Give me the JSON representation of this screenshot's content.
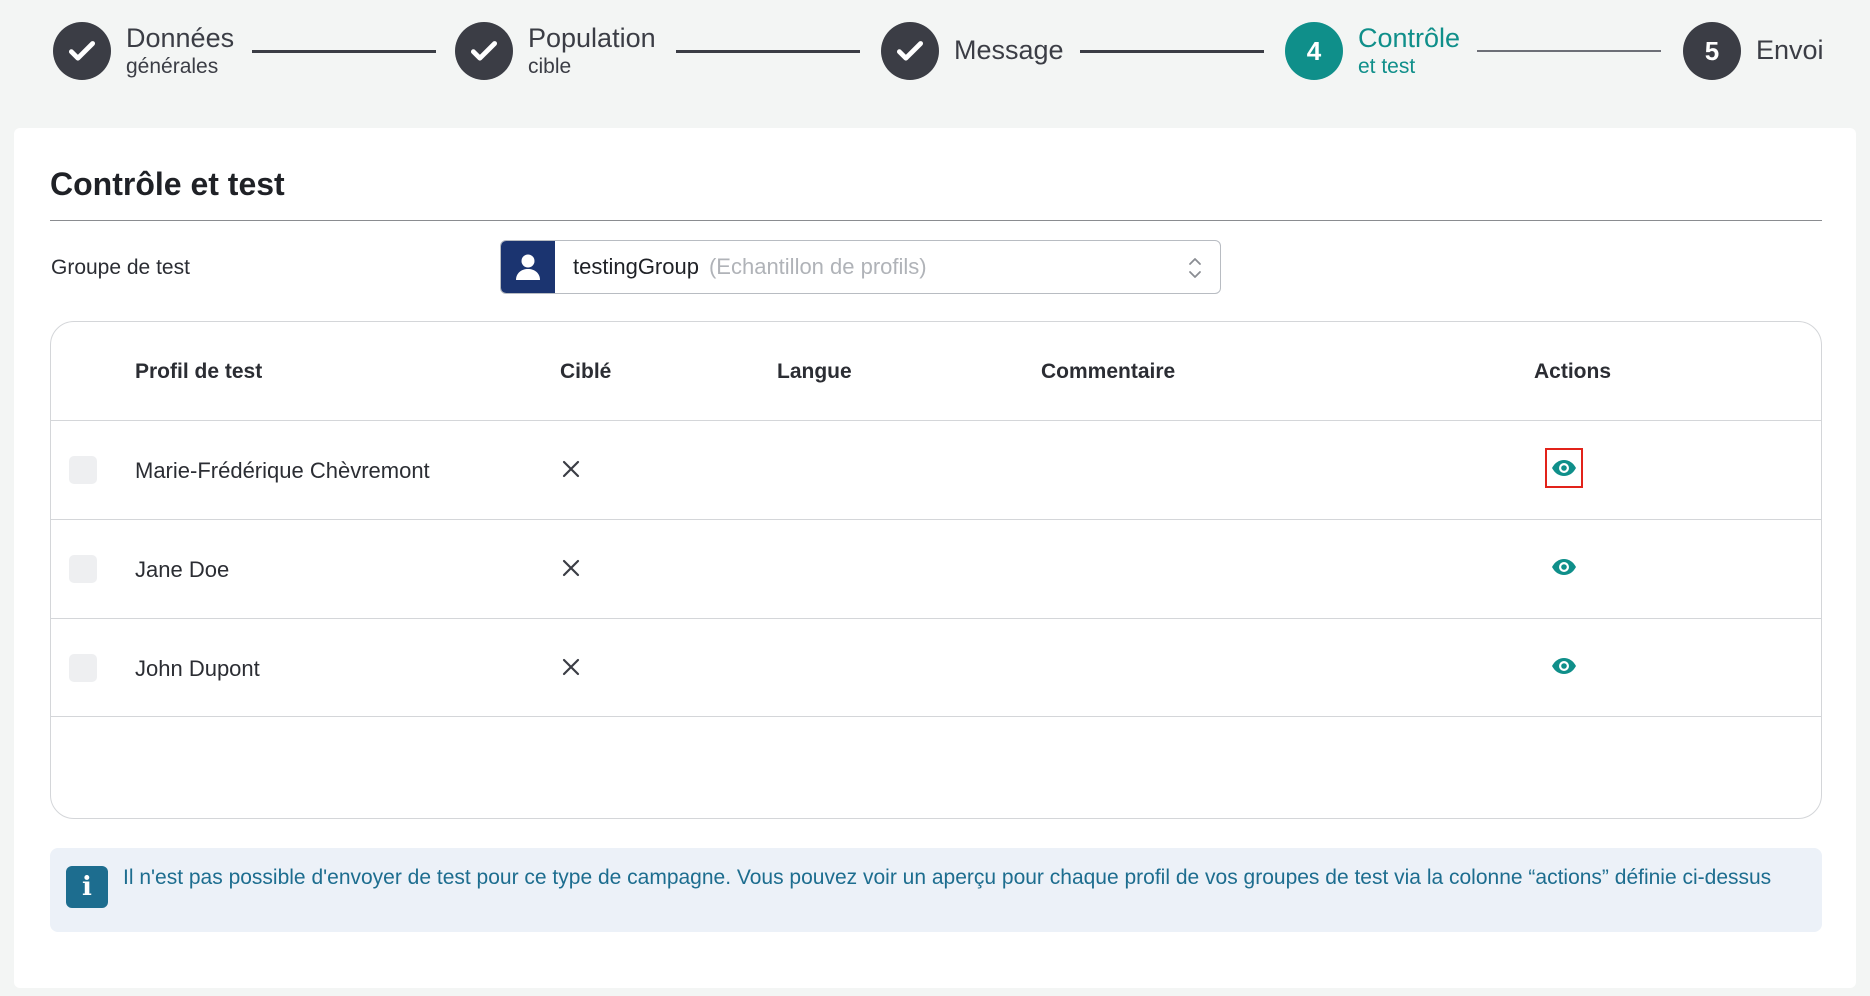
{
  "colors": {
    "accent": "#0f8f8a",
    "step_dark": "#3b3d45",
    "select_icon_bg": "#1b3470",
    "info_text": "#1d6d8f",
    "info_bg": "#ecf1f8",
    "focus_outline": "#e2231a"
  },
  "stepper": {
    "steps": [
      {
        "title": "Données",
        "subtitle": "générales",
        "state": "done",
        "icon": "check-icon"
      },
      {
        "title": "Population",
        "subtitle": "cible",
        "state": "done",
        "icon": "check-icon"
      },
      {
        "title": "Message",
        "subtitle": "",
        "state": "done",
        "icon": "check-icon"
      },
      {
        "number": "4",
        "title": "Contrôle",
        "subtitle": "et test",
        "state": "active"
      },
      {
        "number": "5",
        "title": "Envoi",
        "subtitle": "",
        "state": "pending"
      }
    ]
  },
  "main": {
    "title": "Contrôle et test",
    "test_group_label": "Groupe de test",
    "select": {
      "icon": "user-icon",
      "value": "testingGroup",
      "hint": "(Echantillon de profils)"
    },
    "table": {
      "headers": {
        "profile": "Profil de test",
        "targeted": "Ciblé",
        "language": "Langue",
        "comment": "Commentaire",
        "actions": "Actions"
      },
      "rows": [
        {
          "name": "Marie-Frédérique Chèvremont",
          "targeted_icon": "close-icon",
          "language": "",
          "comment": "",
          "action_icon": "eye-icon"
        },
        {
          "name": "Jane Doe",
          "targeted_icon": "close-icon",
          "language": "",
          "comment": "",
          "action_icon": "eye-icon"
        },
        {
          "name": "John Dupont",
          "targeted_icon": "close-icon",
          "language": "",
          "comment": "",
          "action_icon": "eye-icon"
        }
      ]
    },
    "info": {
      "icon": "info-icon",
      "text": "Il n'est pas possible d'envoyer de test pour ce type de campagne. Vous pouvez voir un aperçu pour chaque profil de vos groupes de test via la colonne “actions” définie ci-dessus"
    }
  }
}
